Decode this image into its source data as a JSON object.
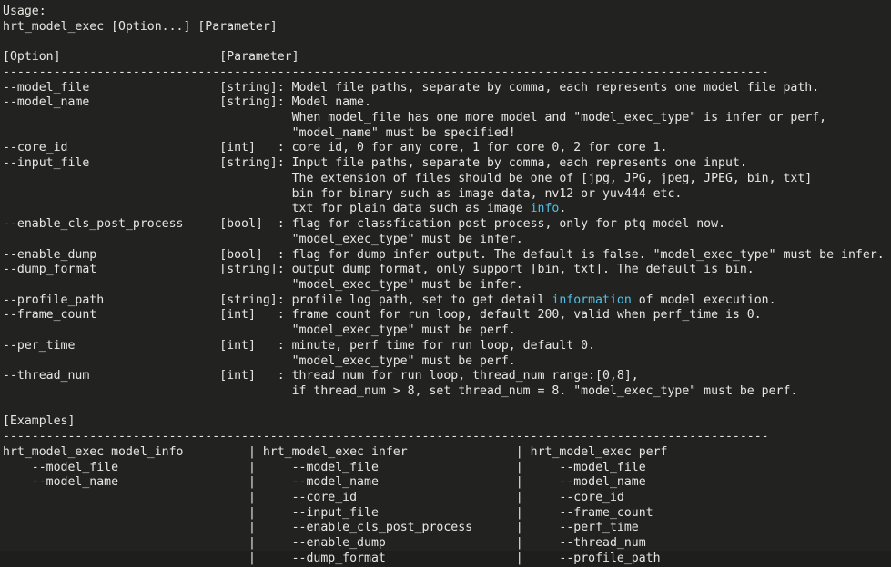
{
  "terminal": {
    "background_color": "#222321",
    "foreground_color": "#e8e6e1",
    "highlight_color": "#4fc1e9",
    "command": "hrt_model_exec",
    "usage_label": "Usage:",
    "usage_line": "hrt_model_exec [Option...] [Parameter]",
    "headers": {
      "option": "[Option]",
      "parameter": "[Parameter]"
    },
    "separator_top": "----------------------------------------------------------------------------------------------------------",
    "separator_examples": "----------------------------------------------------------------------------------------------------------",
    "examples_label": "[Examples]",
    "column_positions": {
      "option_col": 0,
      "type_col": 30,
      "desc_col": 40,
      "example_pipe1_col": 34,
      "example_pipe2_col": 71
    },
    "options": [
      {
        "name": "--model_file",
        "type": "[string]:",
        "lines": [
          [
            {
              "t": "Model file paths, separate by comma, each represents one model file path."
            }
          ]
        ]
      },
      {
        "name": "--model_name",
        "type": "[string]:",
        "lines": [
          [
            {
              "t": "Model name."
            }
          ],
          [
            {
              "t": "When model_file has one more model and \"model_exec_type\" is infer or perf,"
            }
          ],
          [
            {
              "t": "\"model_name\" must be specified!"
            }
          ]
        ]
      },
      {
        "name": "--core_id",
        "type": "[int]   :",
        "lines": [
          [
            {
              "t": "core id, 0 for any core, 1 for core 0, 2 for core 1."
            }
          ]
        ]
      },
      {
        "name": "--input_file",
        "type": "[string]:",
        "lines": [
          [
            {
              "t": "Input file paths, separate by comma, each represents one input."
            }
          ],
          [
            {
              "t": "The extension of files should be one of [jpg, JPG, jpeg, JPEG, bin, txt]"
            }
          ],
          [
            {
              "t": "bin for binary such as image data, nv12 or yuv444 etc."
            }
          ],
          [
            {
              "t": "txt for plain data such as image "
            },
            {
              "t": "info",
              "hl": true
            },
            {
              "t": "."
            }
          ]
        ]
      },
      {
        "name": "--enable_cls_post_process",
        "type": "[bool]  :",
        "lines": [
          [
            {
              "t": "flag for classfication post process, only for ptq model now."
            }
          ],
          [
            {
              "t": "\"model_exec_type\" must be infer."
            }
          ]
        ]
      },
      {
        "name": "--enable_dump",
        "type": "[bool]  :",
        "lines": [
          [
            {
              "t": "flag for dump infer output. The default is false. \"model_exec_type\" must be infer."
            }
          ]
        ]
      },
      {
        "name": "--dump_format",
        "type": "[string]:",
        "lines": [
          [
            {
              "t": "output dump format, only support [bin, txt]. The default is bin."
            }
          ],
          [
            {
              "t": "\"model_exec_type\" must be infer."
            }
          ]
        ]
      },
      {
        "name": "--profile_path",
        "type": "[string]:",
        "lines": [
          [
            {
              "t": "profile log path, set to get detail "
            },
            {
              "t": "information",
              "hl": true
            },
            {
              "t": " of model execution."
            }
          ]
        ]
      },
      {
        "name": "--frame_count",
        "type": "[int]   :",
        "lines": [
          [
            {
              "t": "frame count for run loop, default 200, valid when perf_time is 0."
            }
          ],
          [
            {
              "t": "\"model_exec_type\" must be perf."
            }
          ]
        ]
      },
      {
        "name": "--per_time",
        "type": "[int]   :",
        "lines": [
          [
            {
              "t": "minute, perf time for run loop, default 0."
            }
          ],
          [
            {
              "t": "\"model_exec_type\" must be perf."
            }
          ]
        ]
      },
      {
        "name": "--thread_num",
        "type": "[int]   :",
        "lines": [
          [
            {
              "t": "thread num for run loop, thread_num range:[0,8],"
            }
          ],
          [
            {
              "t": "if thread_num > 8, set thread_num = 8. \"model_exec_type\" must be perf."
            }
          ]
        ]
      }
    ],
    "examples": {
      "separator": "|",
      "columns": [
        {
          "header": "hrt_model_exec model_info",
          "flags": [
            "--model_file",
            "--model_name"
          ]
        },
        {
          "header": "hrt_model_exec infer",
          "flags": [
            "--model_file",
            "--model_name",
            "--core_id",
            "--input_file",
            "--enable_cls_post_process",
            "--enable_dump",
            "--dump_format"
          ]
        },
        {
          "header": "hrt_model_exec perf",
          "flags": [
            "--model_file",
            "--model_name",
            "--core_id",
            "--frame_count",
            "--perf_time",
            "--thread_num",
            "--profile_path"
          ]
        }
      ]
    }
  }
}
